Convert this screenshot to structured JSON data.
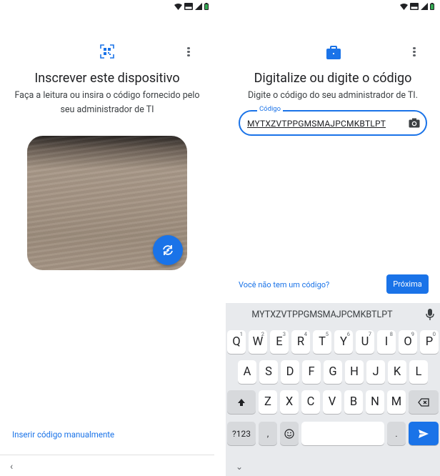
{
  "left_screen": {
    "title": "Inscrever este dispositivo",
    "subtitle": "Faça a leitura ou insira o código fornecido pelo seu administrador de TI",
    "icons": {
      "top": "qr-scan-icon",
      "menu": "more-vert-icon",
      "camera_toggle": "switch-camera-icon"
    },
    "manual_link": "Inserir código manualmente",
    "nav_back": "‹"
  },
  "right_screen": {
    "title": "Digitalize ou digite o código",
    "subtitle": "Digite o código do seu administrador de TI.",
    "icons": {
      "top": "briefcase-icon",
      "menu": "more-vert-icon",
      "camera": "camera-icon"
    },
    "code_field": {
      "label": "Código",
      "value": "MYTXZVTPPGMSMAJPCMKBTLPT"
    },
    "no_code_link": "Você não tem um código?",
    "next_button": "Próxima",
    "nav_down": "⌄",
    "keyboard": {
      "suggestion": "MYTXZVTPPGMSMAJPCMKBTLPT",
      "row1": [
        {
          "k": "Q",
          "n": "1"
        },
        {
          "k": "W",
          "n": "2"
        },
        {
          "k": "E",
          "n": "3"
        },
        {
          "k": "R",
          "n": "4"
        },
        {
          "k": "T",
          "n": "5"
        },
        {
          "k": "Y",
          "n": "6"
        },
        {
          "k": "U",
          "n": "7"
        },
        {
          "k": "I",
          "n": "8"
        },
        {
          "k": "O",
          "n": "9"
        },
        {
          "k": "P",
          "n": "0"
        }
      ],
      "row2": [
        "A",
        "S",
        "D",
        "F",
        "G",
        "H",
        "J",
        "K",
        "L"
      ],
      "row3": [
        "Z",
        "X",
        "C",
        "V",
        "B",
        "N",
        "M"
      ],
      "symbols": "?123",
      "comma": ",",
      "period": "."
    }
  },
  "colors": {
    "accent": "#1a73e8",
    "keyboard_bg": "#e8eaed"
  }
}
